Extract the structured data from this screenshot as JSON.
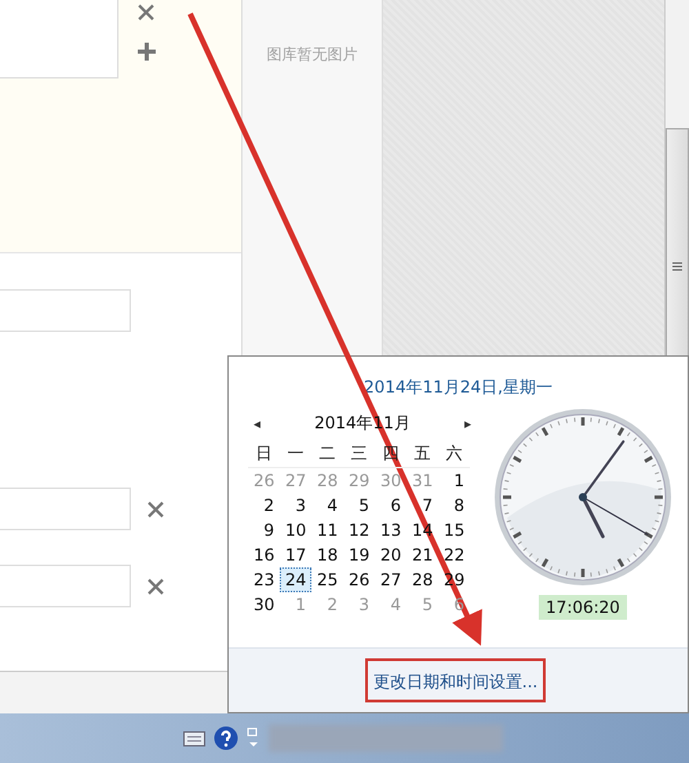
{
  "gallery": {
    "empty_message": "图库暂无图片"
  },
  "clock_popup": {
    "date_heading": "2014年11月24日,星期一",
    "month_label": "2014年11月",
    "prev": "◂",
    "next": "▸",
    "weekdays": [
      "日",
      "一",
      "二",
      "三",
      "四",
      "五",
      "六"
    ],
    "weeks": [
      [
        {
          "day": "26",
          "muted": true,
          "selected": false
        },
        {
          "day": "27",
          "muted": true,
          "selected": false
        },
        {
          "day": "28",
          "muted": true,
          "selected": false
        },
        {
          "day": "29",
          "muted": true,
          "selected": false
        },
        {
          "day": "30",
          "muted": true,
          "selected": false
        },
        {
          "day": "31",
          "muted": true,
          "selected": false
        },
        {
          "day": "1",
          "muted": false,
          "selected": false
        }
      ],
      [
        {
          "day": "2",
          "muted": false,
          "selected": false
        },
        {
          "day": "3",
          "muted": false,
          "selected": false
        },
        {
          "day": "4",
          "muted": false,
          "selected": false
        },
        {
          "day": "5",
          "muted": false,
          "selected": false
        },
        {
          "day": "6",
          "muted": false,
          "selected": false
        },
        {
          "day": "7",
          "muted": false,
          "selected": false
        },
        {
          "day": "8",
          "muted": false,
          "selected": false
        }
      ],
      [
        {
          "day": "9",
          "muted": false,
          "selected": false
        },
        {
          "day": "10",
          "muted": false,
          "selected": false
        },
        {
          "day": "11",
          "muted": false,
          "selected": false
        },
        {
          "day": "12",
          "muted": false,
          "selected": false
        },
        {
          "day": "13",
          "muted": false,
          "selected": false
        },
        {
          "day": "14",
          "muted": false,
          "selected": false
        },
        {
          "day": "15",
          "muted": false,
          "selected": false
        }
      ],
      [
        {
          "day": "16",
          "muted": false,
          "selected": false
        },
        {
          "day": "17",
          "muted": false,
          "selected": false
        },
        {
          "day": "18",
          "muted": false,
          "selected": false
        },
        {
          "day": "19",
          "muted": false,
          "selected": false
        },
        {
          "day": "20",
          "muted": false,
          "selected": false
        },
        {
          "day": "21",
          "muted": false,
          "selected": false
        },
        {
          "day": "22",
          "muted": false,
          "selected": false
        }
      ],
      [
        {
          "day": "23",
          "muted": false,
          "selected": false
        },
        {
          "day": "24",
          "muted": false,
          "selected": true
        },
        {
          "day": "25",
          "muted": false,
          "selected": false
        },
        {
          "day": "26",
          "muted": false,
          "selected": false
        },
        {
          "day": "27",
          "muted": false,
          "selected": false
        },
        {
          "day": "28",
          "muted": false,
          "selected": false
        },
        {
          "day": "29",
          "muted": false,
          "selected": false
        }
      ],
      [
        {
          "day": "30",
          "muted": false,
          "selected": false
        },
        {
          "day": "1",
          "muted": true,
          "selected": false
        },
        {
          "day": "2",
          "muted": true,
          "selected": false
        },
        {
          "day": "3",
          "muted": true,
          "selected": false
        },
        {
          "day": "4",
          "muted": true,
          "selected": false
        },
        {
          "day": "5",
          "muted": true,
          "selected": false
        },
        {
          "day": "6",
          "muted": true,
          "selected": false
        }
      ]
    ],
    "time": "17:06:20",
    "settings_link": "更改日期和时间设置..."
  }
}
